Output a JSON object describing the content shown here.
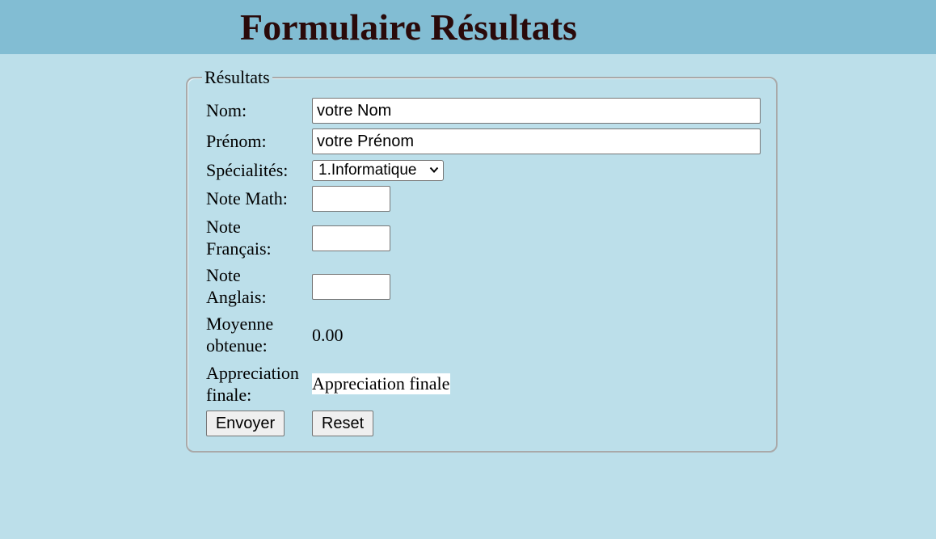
{
  "header": {
    "title": "Formulaire Résultats"
  },
  "form": {
    "legend": "Résultats",
    "fields": {
      "nom": {
        "label": "Nom:",
        "value": "votre Nom"
      },
      "prenom": {
        "label": "Prénom:",
        "value": "votre Prénom"
      },
      "specialites": {
        "label": "Spécialités:",
        "selected": "1.Informatique"
      },
      "note_math": {
        "label": "Note Math:",
        "value": ""
      },
      "note_francais": {
        "label_line1": "Note",
        "label_line2": "Français:",
        "value": ""
      },
      "note_anglais": {
        "label_line1": "Note",
        "label_line2": "Anglais:",
        "value": ""
      },
      "moyenne": {
        "label_line1": "Moyenne",
        "label_line2": "obtenue:",
        "value": "0.00"
      },
      "appreciation": {
        "label_line1": "Appreciation",
        "label_line2": "finale:",
        "value": "Appreciation finale"
      }
    },
    "buttons": {
      "submit": "Envoyer",
      "reset": "Reset"
    }
  },
  "colors": {
    "page_background": "#bcdfea",
    "header_background": "#82bdd3",
    "title_color": "#2a0a0a"
  }
}
